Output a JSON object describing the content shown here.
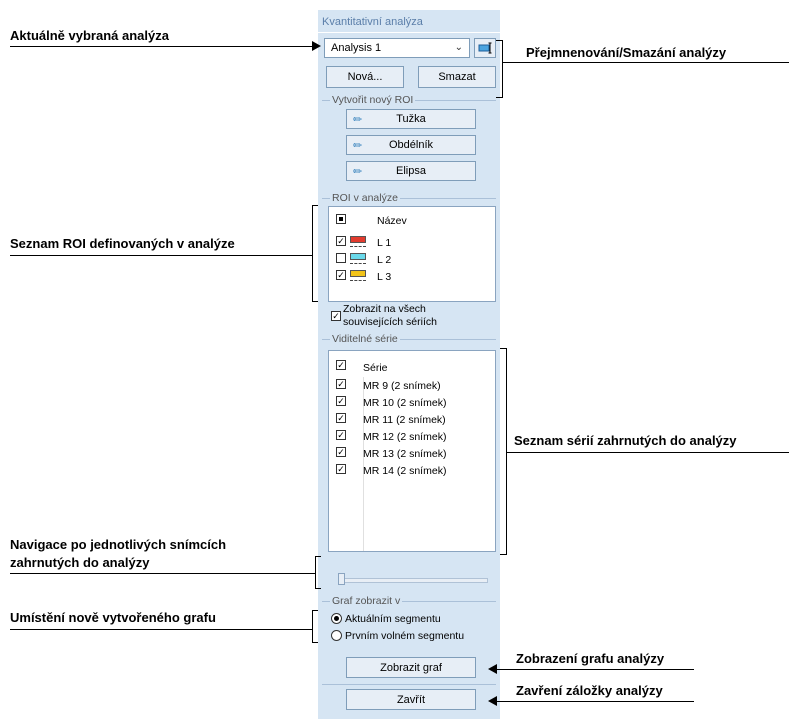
{
  "panel": {
    "title": "Kvantitativní analýza",
    "analysis_select": "Analysis 1",
    "new_button": "Nová...",
    "delete_button": "Smazat",
    "create_roi_label": "Vytvořit nový ROI",
    "roi_buttons": [
      "Tužka",
      "Obdélník",
      "Elipsa"
    ],
    "roi_section_label": "ROI v analýze",
    "roi_header": "Název",
    "rois": [
      {
        "name": "L 1",
        "checked": true,
        "color": "#e23b2e"
      },
      {
        "name": "L 2",
        "checked": false,
        "color": "#6ad9ea"
      },
      {
        "name": "L 3",
        "checked": true,
        "color": "#f2c419"
      }
    ],
    "show_all_label_1": "Zobrazit na všech",
    "show_all_label_2": "souvisejících sériích",
    "visible_series_label": "Viditelné série",
    "series_header": "Série",
    "series": [
      "MR 9 (2 snímek)",
      "MR 10 (2 snímek)",
      "MR 11 (2 snímek)",
      "MR 12 (2 snímek)",
      "MR 13 (2 snímek)",
      "MR 14 (2 snímek)"
    ],
    "graph_section_label": "Graf zobrazit v",
    "radio_current": "Aktuálním segmentu",
    "radio_first_free": "Prvním volném segmentu",
    "show_graph_button": "Zobrazit graf",
    "close_button": "Zavřít"
  },
  "annotations": {
    "selected_analysis": "Aktuálně vybraná analýza",
    "rename_delete": "Přejmnenování/Smazání analýzy",
    "roi_list": "Seznam ROI definovaných v analýze",
    "series_list": "Seznam sérií zahrnutých do analýzy",
    "navigation_1": "Navigace po jednotlivých snímcích",
    "navigation_2": "zahrnutých do analýzy",
    "graph_placement": "Umístění nově vytvořeného grafu",
    "show_graph": "Zobrazení grafu analýzy",
    "close_tab": "Zavření záložky analýzy"
  },
  "colors": {
    "panel_bg": "#d6e5f3",
    "button_border": "#7f9db9",
    "title_text": "#5a7ea9"
  }
}
